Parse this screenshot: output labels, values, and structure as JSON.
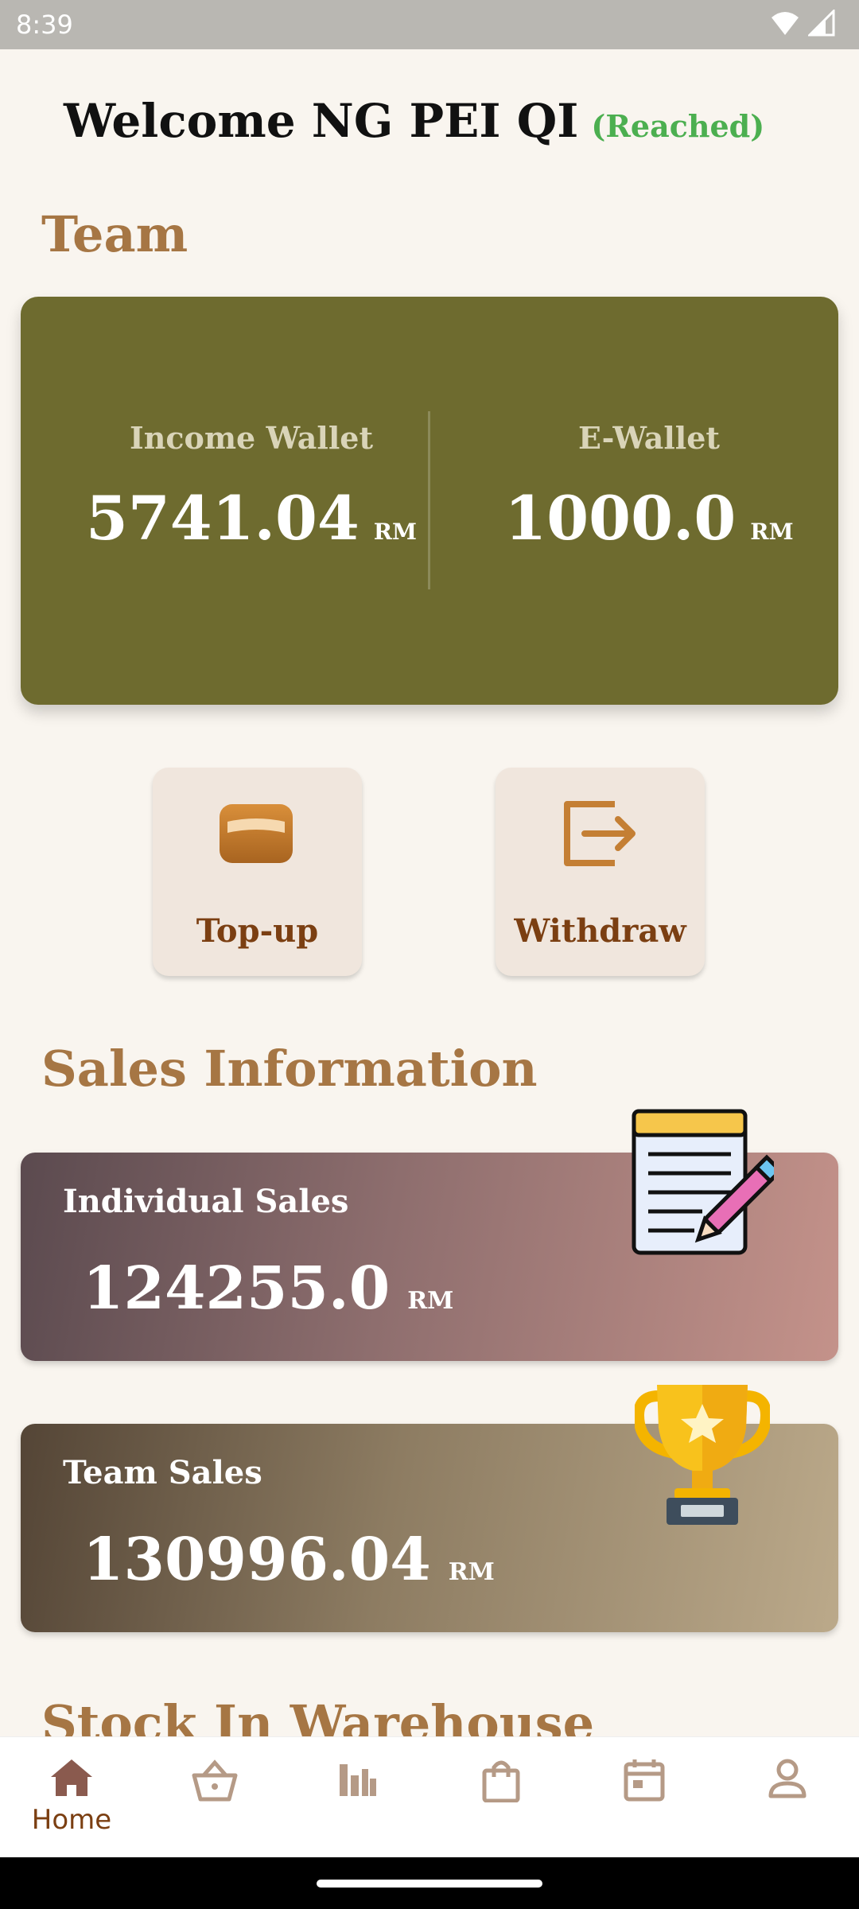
{
  "status_bar": {
    "time": "8:39",
    "wifi_icon": "wifi-icon",
    "signal_icon": "signal-icon"
  },
  "header": {
    "welcome_text": "Welcome NG PEI QI",
    "status": "(Reached)"
  },
  "team_section": {
    "title": "Team",
    "income_wallet": {
      "label": "Income Wallet",
      "amount": "5741.04",
      "unit": "RM"
    },
    "e_wallet": {
      "label": "E-Wallet",
      "amount": "1000.0",
      "unit": "RM"
    }
  },
  "actions": [
    {
      "label": "Top-up",
      "icon": "wallet-icon"
    },
    {
      "label": "Withdraw",
      "icon": "withdraw-icon"
    }
  ],
  "sales_section": {
    "title": "Sales Information",
    "individual": {
      "label": "Individual Sales",
      "amount": "124255.0",
      "unit": "RM",
      "icon": "notepad-pencil-icon"
    },
    "team": {
      "label": "Team Sales",
      "amount": "130996.04",
      "unit": "RM",
      "icon": "trophy-icon"
    }
  },
  "stock_section": {
    "title": "Stock In Warehouse"
  },
  "bottom_nav": [
    {
      "label": "Home",
      "icon": "home-icon",
      "active": true
    },
    {
      "label": "",
      "icon": "basket-icon",
      "active": false
    },
    {
      "label": "",
      "icon": "stats-icon",
      "active": false
    },
    {
      "label": "",
      "icon": "shopping-bag-icon",
      "active": false
    },
    {
      "label": "",
      "icon": "calendar-icon",
      "active": false
    },
    {
      "label": "",
      "icon": "profile-icon",
      "active": false
    }
  ],
  "colors": {
    "accent": "#a67644",
    "team_card": "#6e6b2f",
    "reached": "#4caf50",
    "nav_active": "#7b3f12",
    "nav_inactive": "#b59a86"
  }
}
